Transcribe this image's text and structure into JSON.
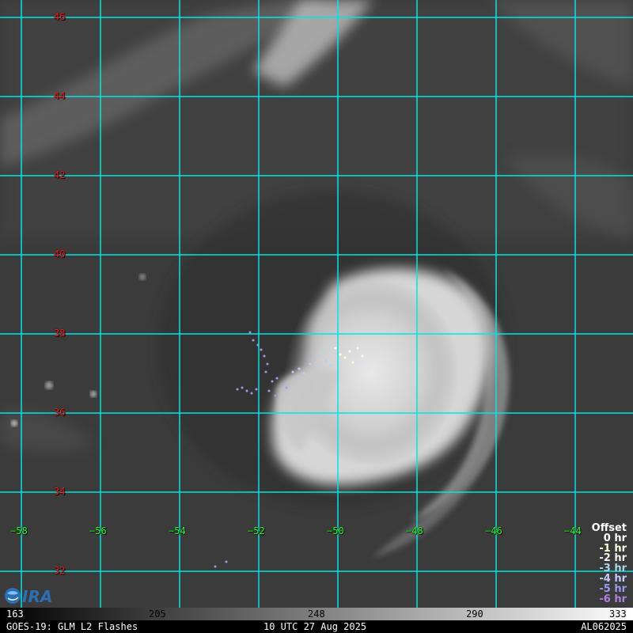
{
  "map": {
    "lat_labels": [
      {
        "text": "46",
        "lat": 46
      },
      {
        "text": "44",
        "lat": 44
      },
      {
        "text": "42",
        "lat": 42
      },
      {
        "text": "40",
        "lat": 40
      },
      {
        "text": "38",
        "lat": 38
      },
      {
        "text": "36",
        "lat": 36
      },
      {
        "text": "34",
        "lat": 34
      },
      {
        "text": "32",
        "lat": 32
      }
    ],
    "lon_labels": [
      {
        "text": "−58",
        "lon": -58
      },
      {
        "text": "−56",
        "lon": -56
      },
      {
        "text": "−54",
        "lon": -54
      },
      {
        "text": "−52",
        "lon": -52
      },
      {
        "text": "−50",
        "lon": -50
      },
      {
        "text": "−48",
        "lon": -48
      },
      {
        "text": "−46",
        "lon": -46
      },
      {
        "text": "−44",
        "lon": -44
      }
    ],
    "grid_color": "#00e5e5",
    "lat_label_color": "#ff1a1a",
    "lon_label_color": "#22ff22"
  },
  "legend": {
    "title": "Offset",
    "rows": [
      {
        "label": "0 hr",
        "color": "#ffffff"
      },
      {
        "label": "-1 hr",
        "color": "#ffffe0"
      },
      {
        "label": "-2 hr",
        "color": "#f0f0f0"
      },
      {
        "label": "-3 hr",
        "color": "#a8d8e8"
      },
      {
        "label": "-4 hr",
        "color": "#c8c8ff"
      },
      {
        "label": "-5 hr",
        "color": "#9a9af0"
      },
      {
        "label": "-6 hr",
        "color": "#b080e0"
      }
    ]
  },
  "colorbar": {
    "ticks": [
      "163",
      "205",
      "248",
      "290",
      "333"
    ]
  },
  "footer": {
    "left": "GOES-19: GLM L2 Flashes",
    "center": "10 UTC 27 Aug 2025",
    "right": "AL062025"
  },
  "logo": {
    "icon": "cira-logo"
  }
}
